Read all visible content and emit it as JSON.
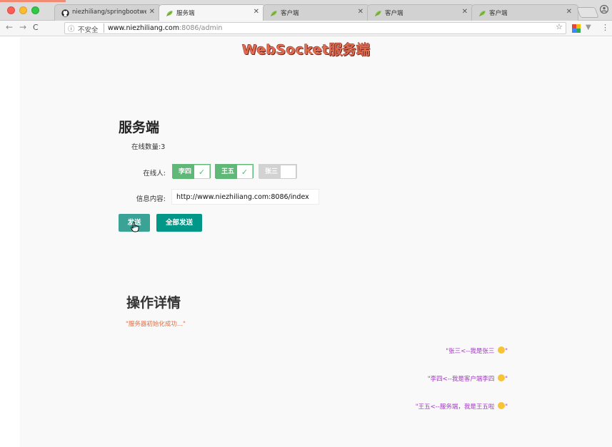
{
  "browser": {
    "tabs": [
      {
        "title": "niezhiliang/springbootwebs",
        "favicon": "github-icon",
        "active": false
      },
      {
        "title": "服务端",
        "favicon": "leaf-icon",
        "active": true
      },
      {
        "title": "客户端",
        "favicon": "leaf-icon",
        "active": false
      },
      {
        "title": "客户端",
        "favicon": "leaf-icon",
        "active": false
      },
      {
        "title": "客户端",
        "favicon": "leaf-icon",
        "active": false
      }
    ],
    "address": {
      "security_label": "不安全",
      "host": "www.niezhiliang.com",
      "path": ":8086/admin"
    }
  },
  "page": {
    "title": "WebSocket服务端",
    "server_heading": "服务端",
    "online_count_label": "在线数量:",
    "online_count_value": "3",
    "online_users_label": "在线人:",
    "online_users": [
      {
        "name": "李四",
        "selected": true
      },
      {
        "name": "王五",
        "selected": true
      },
      {
        "name": "张三",
        "selected": false
      }
    ],
    "message_label": "信息内容:",
    "message_value": "http://www.niezhiliang.com:8086/index",
    "send_label": "发送",
    "send_all_label": "全部发送",
    "detail_heading": "操作详情",
    "log_init": "\"服务器初始化成功...\"",
    "log_messages": [
      {
        "text": "\"张三<--我是张三",
        "suffix": "\""
      },
      {
        "text": "\"李四<--我是客户端李四",
        "suffix": "\""
      },
      {
        "text": "\"王五<--服务端，我是王五啦",
        "suffix": "\""
      }
    ]
  },
  "colors": {
    "accent": "#009688",
    "selected_tag": "#5fb878",
    "title": "#e26a4f",
    "log_text": "#a03bc0",
    "init_text": "#e06f45"
  }
}
